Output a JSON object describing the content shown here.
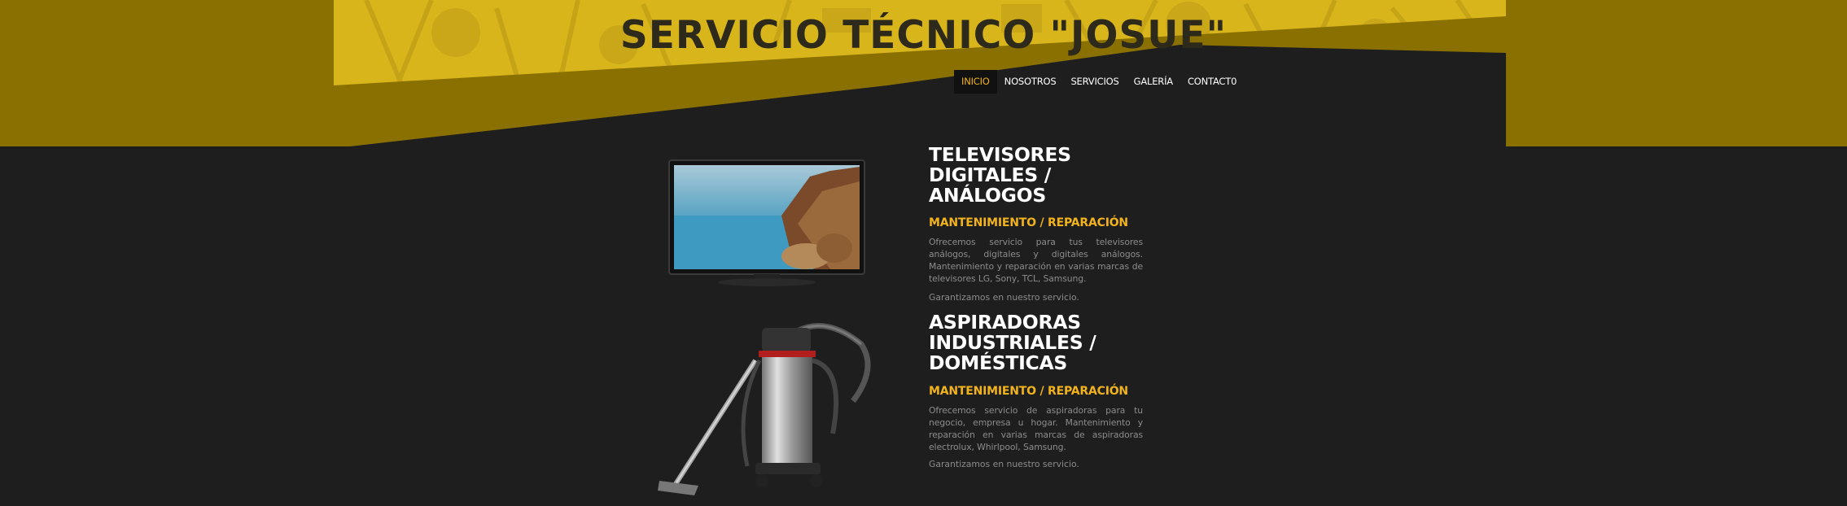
{
  "header": {
    "site_title": "SERVICIO TÉCNICO \"JOSUE\""
  },
  "nav": {
    "items": [
      {
        "label": "INICIO",
        "active": true
      },
      {
        "label": "NOSOTROS",
        "active": false
      },
      {
        "label": "SERVICIOS",
        "active": false
      },
      {
        "label": "GALERÍA",
        "active": false
      },
      {
        "label": "CONTACT0",
        "active": false
      }
    ]
  },
  "services": [
    {
      "title_lines": [
        "TELEVISORES",
        "DIGITALES / ANÁLOGOS"
      ],
      "subtitle": "MANTENIMIENTO / REPARACIÓN",
      "description": "Ofrecemos servicio para tus televisores análogos, digitales y digitales análogos. Mantenimiento y reparación en varias marcas de televisores LG, Sony, TCL, Samsung.",
      "note": "Garantizamos en nuestro servicio.",
      "image": "television-image"
    },
    {
      "title_lines": [
        "ASPIRADORAS",
        "INDUSTRIALES /",
        "DOMÉSTICAS"
      ],
      "subtitle": "MANTENIMIENTO / REPARACIÓN",
      "description": "Ofrecemos servicio de aspiradoras para tu negocio, empresa u hogar. Mantenimiento y reparación en varias marcas de aspiradoras electrolux, Whirlpool, Samsung.",
      "note": "Garantizamos en nuestro servicio.",
      "image": "vacuum-cleaner-image"
    }
  ],
  "colors": {
    "accent": "#f2b31c",
    "hero_yellow": "#d9b51c",
    "hero_dark": "#8a7000",
    "background": "#1e1e1e"
  }
}
